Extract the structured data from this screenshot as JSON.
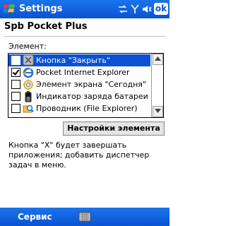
{
  "titlebar": {
    "title": "Settings",
    "ok_label": "ok"
  },
  "status_icons": [
    "connectivity-icon",
    "signal-icon",
    "volume-icon"
  ],
  "header": {
    "title": "Spb Pocket Plus"
  },
  "element_list": {
    "label": "Элемент:",
    "items": [
      {
        "label": "Кнопка \"Закрыть\"",
        "checked": false,
        "selected": true,
        "icon": "close-button-icon"
      },
      {
        "label": "Pocket Internet Explorer",
        "checked": true,
        "selected": false,
        "icon": "internet-explorer-icon"
      },
      {
        "label": "Элемент экрана \"Сегодня\"",
        "checked": false,
        "selected": false,
        "icon": "today-screen-icon"
      },
      {
        "label": "Индикатор заряда батареи",
        "checked": false,
        "selected": false,
        "icon": "battery-icon"
      },
      {
        "label": "Проводник (File Explorer)",
        "checked": false,
        "selected": false,
        "icon": "file-explorer-icon"
      }
    ]
  },
  "settings_button": {
    "label": "Настройки элемента"
  },
  "help_text": "Кнопка \"X\" будет завершать приложения; добавить диспетчер задач в меню.",
  "bottombar": {
    "menu_label": "Сервис",
    "sip_icon": "keyboard-icon"
  },
  "colors": {
    "title_bar": "#0a52d2",
    "selection": "#0a52d2",
    "background": "#ffffff"
  }
}
